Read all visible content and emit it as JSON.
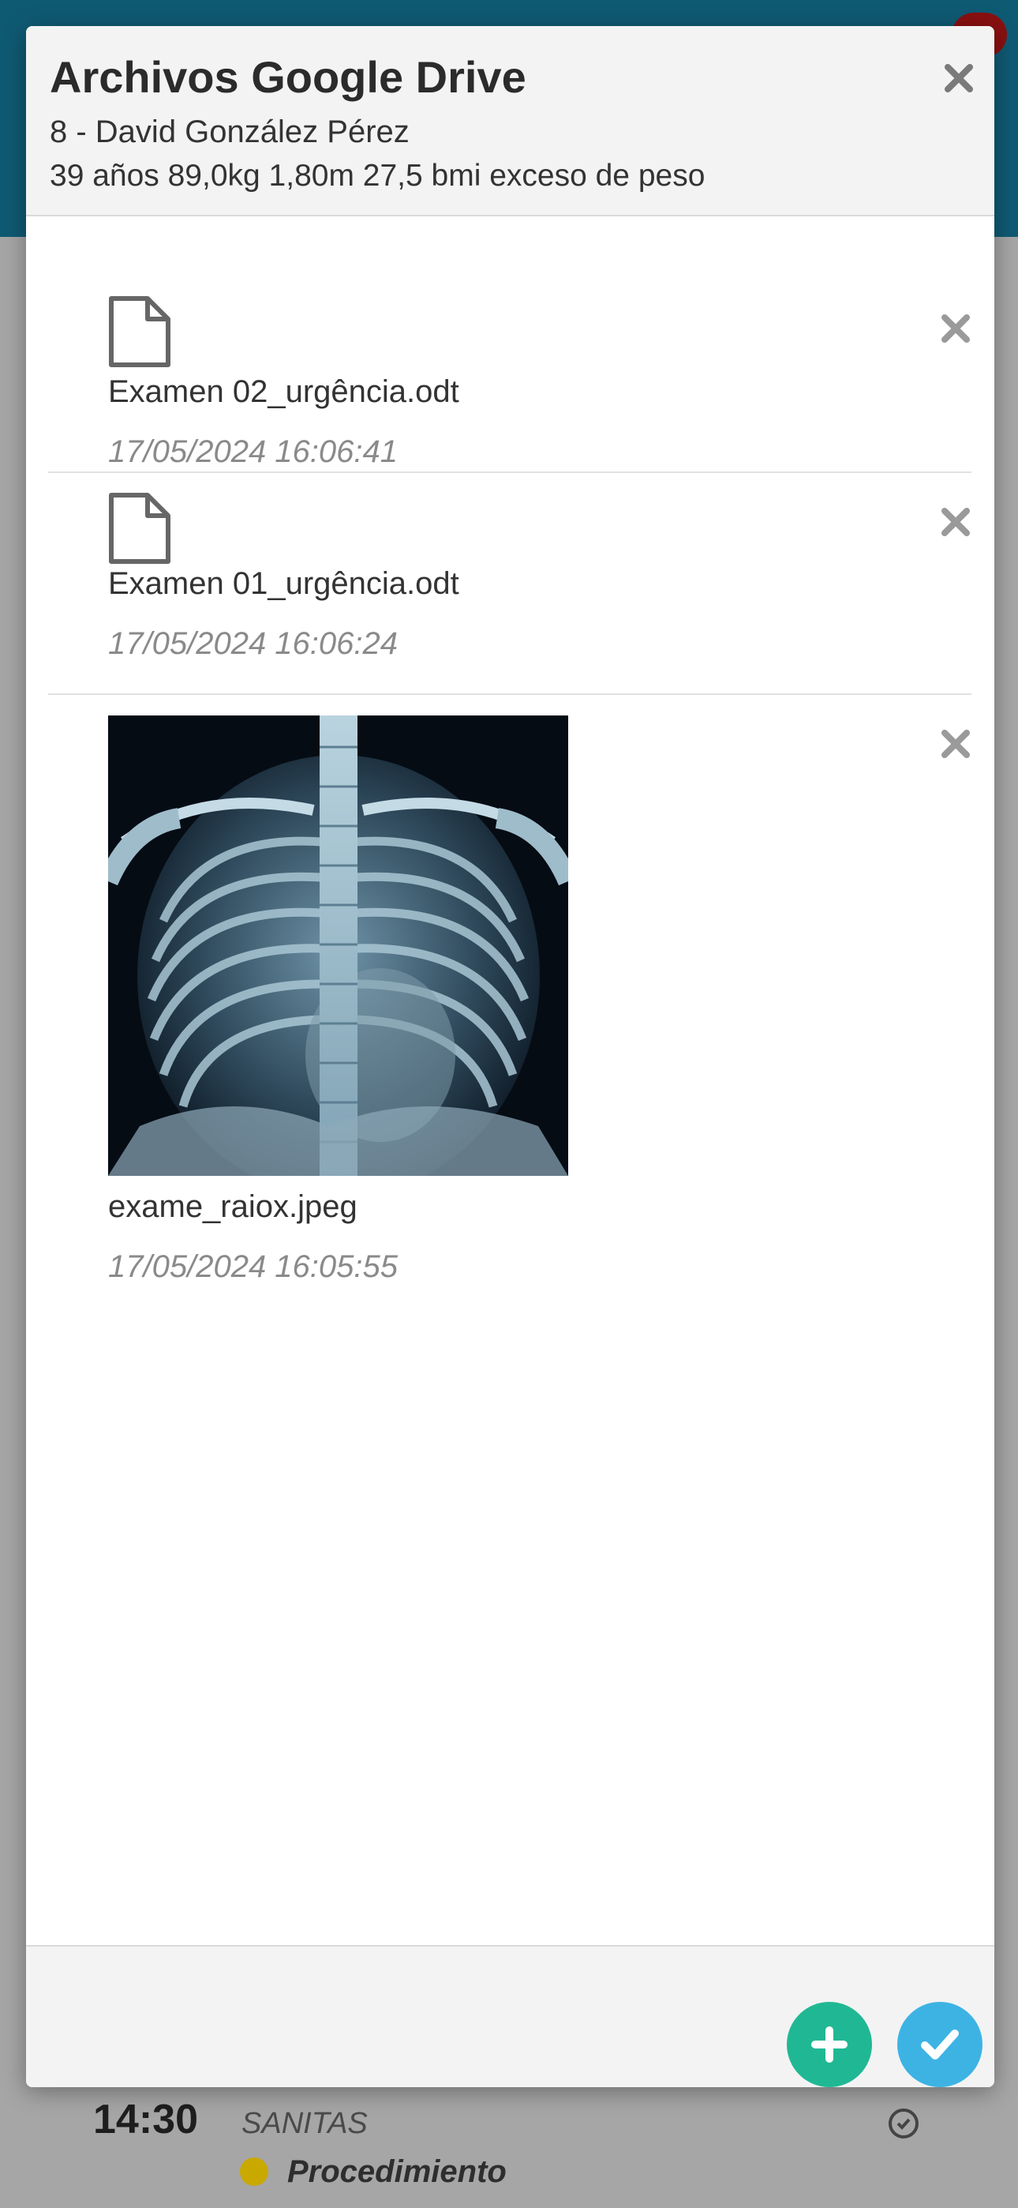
{
  "modal": {
    "title": "Archivos Google Drive",
    "patient": "8 - David González Pérez",
    "info": "39 años 89,0kg 1,80m 27,5 bmi exceso de peso"
  },
  "files": [
    {
      "name": "Examen 02_urgência.odt",
      "date": "17/05/2024 16:06:41",
      "icon": "document-icon"
    },
    {
      "name": "Examen 01_urgência.odt",
      "date": "17/05/2024 16:06:24",
      "icon": "document-icon"
    },
    {
      "name": "exame_raiox.jpeg",
      "date": "17/05/2024 16:05:55",
      "icon": "xray-image"
    }
  ],
  "background": {
    "time": "14:30",
    "insurer": "SANITAS",
    "procedure": "Procedimiento"
  },
  "colors": {
    "header_bar": "#0f5a73",
    "add_button": "#20b894",
    "confirm_button": "#3db3e4",
    "status_dot": "#c9a800"
  }
}
